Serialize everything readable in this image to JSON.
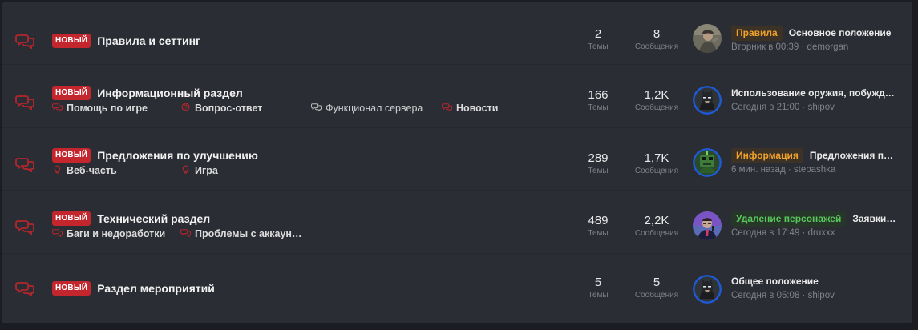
{
  "colors": {
    "accent_red": "#c4262e",
    "icon_red": "#b3262b",
    "panel_bg": "#2b2d35"
  },
  "labels": {
    "threads": "Темы",
    "messages": "Сообщения"
  },
  "nodes": [
    {
      "badge": "НОВЫЙ",
      "title": "Правила и сеттинг",
      "threads": "2",
      "messages": "8",
      "subforums": [],
      "last": {
        "prefix": "Правила",
        "prefix_color": "#f0a22c",
        "prefix_bg": "#3d3226",
        "title": "Основное положение",
        "time": "Вторник в 00:39",
        "user": "demorgan",
        "avatar": "avatar-photo-icon"
      }
    },
    {
      "badge": "НОВЫЙ",
      "title": "Информационный раздел",
      "threads": "166",
      "messages": "1,2K",
      "subforums": [
        {
          "label": "Помощь по игре",
          "icon": "chat-bubbles-icon"
        },
        {
          "label": "Вопрос-ответ",
          "icon": "question-circle-icon"
        },
        {
          "label": "Функционал сервера",
          "icon": "chat-bubbles-icon"
        },
        {
          "label": "Новости",
          "icon": "chat-bubbles-icon"
        }
      ],
      "last": {
        "prefix": "",
        "title": "Использование оружия, побужде…",
        "time": "Сегодня в 21:00",
        "user": "shipov",
        "avatar": "avatar-batman-icon"
      }
    },
    {
      "badge": "НОВЫЙ",
      "title": "Предложения по улучшению",
      "threads": "289",
      "messages": "1,7K",
      "subforums": [
        {
          "label": "Веб-часть",
          "icon": "lightbulb-icon"
        },
        {
          "label": "Игра",
          "icon": "lightbulb-icon"
        }
      ],
      "last": {
        "prefix": "Информация",
        "prefix_color": "#f0a22c",
        "prefix_bg": "#3d3226",
        "title": "Предложения п…",
        "time": "6 мин. назад",
        "user": "stepashka",
        "avatar": "avatar-green-icon"
      }
    },
    {
      "badge": "НОВЫЙ",
      "title": "Технический раздел",
      "threads": "489",
      "messages": "2,2K",
      "subforums": [
        {
          "label": "Баги и недоработки",
          "icon": "chat-bubbles-icon"
        },
        {
          "label": "Проблемы с аккаун…",
          "icon": "chat-bubbles-icon"
        }
      ],
      "last": {
        "prefix": "Удаление персонажей",
        "prefix_color": "#59c95c",
        "prefix_bg": "#263628",
        "title": "Заявки …",
        "time": "Сегодня в 17:49",
        "user": "druxxx",
        "avatar": "avatar-suit-icon"
      }
    },
    {
      "badge": "НОВЫЙ",
      "title": "Раздел мероприятий",
      "threads": "5",
      "messages": "5",
      "subforums": [],
      "last": {
        "prefix": "",
        "title": "Общее положение",
        "time": "Сегодня в 05:08",
        "user": "shipov",
        "avatar": "avatar-batman-icon"
      }
    }
  ]
}
